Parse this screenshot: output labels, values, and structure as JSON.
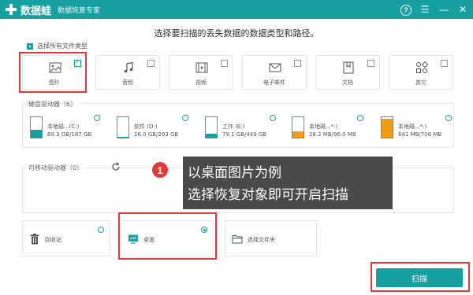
{
  "app": {
    "name": "数据蛙",
    "subtitle": "数据恢复专家",
    "accent_color": "#17a0a0"
  },
  "titlebar": {
    "help_icon": "?",
    "menu_icon": "☰",
    "minimize_icon": "—",
    "close_icon": "✕"
  },
  "instruction": "选择要扫描的丢失数据的数据类型和路径。",
  "select_all_label": "选择所有文件类型",
  "file_types": [
    {
      "label": "图片",
      "icon": "image-icon",
      "checked": true
    },
    {
      "label": "音频",
      "icon": "audio-icon",
      "checked": false
    },
    {
      "label": "视频",
      "icon": "video-icon",
      "checked": false
    },
    {
      "label": "电子邮件",
      "icon": "email-icon",
      "checked": false
    },
    {
      "label": "文档",
      "icon": "document-icon",
      "checked": false
    },
    {
      "label": "其它",
      "icon": "other-icon",
      "checked": false
    }
  ],
  "hard_drives": {
    "title": "硬盘驱动器（6）",
    "items": [
      {
        "name": "本地磁...(C:)",
        "size": "69.3 GB/187 GB",
        "fill_color": "#17a0a0",
        "used_fraction": 0.37
      },
      {
        "name": "软件 (D:)",
        "size": "16.0 GB/293 GB",
        "fill_color": "#17a0a0",
        "used_fraction": 0.05
      },
      {
        "name": "工作 (E:)",
        "size": "79.1 GB/449 GB",
        "fill_color": "#17a0a0",
        "used_fraction": 0.18
      },
      {
        "name": "本地磁...*:)",
        "size": "28.2 MB/96.0 MB",
        "fill_color": "#f39c12",
        "used_fraction": 0.29
      },
      {
        "name": "本地磁...*:)",
        "size": "641 MB/706 MB",
        "fill_color": "#f39c12",
        "used_fraction": 0.91
      }
    ]
  },
  "removable_drives": {
    "title": "可移动驱动器（0）"
  },
  "locations": [
    {
      "label": "回收站",
      "icon": "recycle-bin-icon",
      "selected": false
    },
    {
      "label": "桌面",
      "icon": "desktop-icon",
      "selected": true
    },
    {
      "label": "选择文件夹",
      "icon": "folder-icon",
      "selected": false
    }
  ],
  "scan_button": "扫描",
  "tooltip": {
    "number": "1",
    "line1": "以桌面图片为例",
    "line2": "选择恢复对象即可开启扫描"
  }
}
